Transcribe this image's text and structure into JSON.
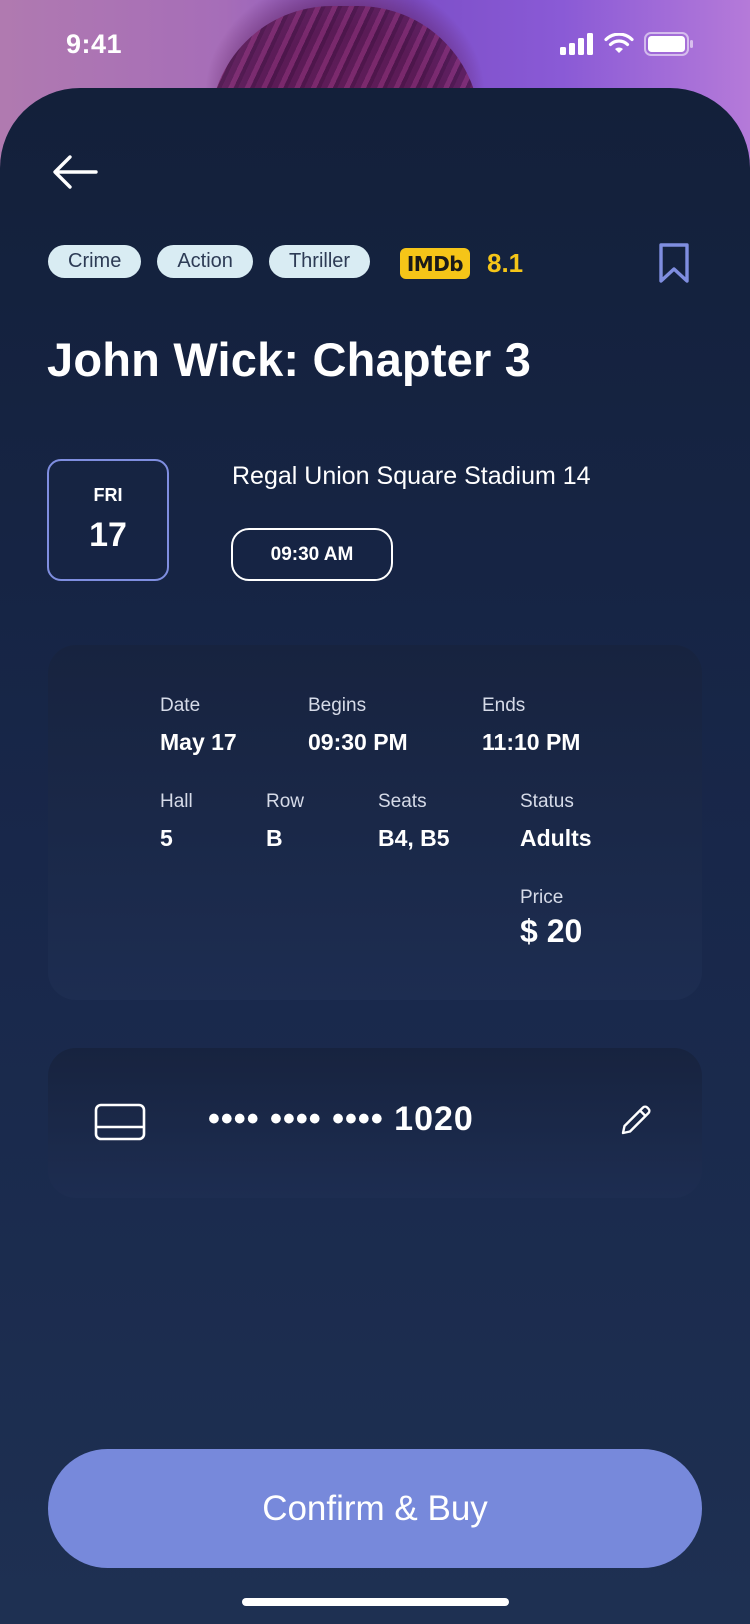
{
  "status_bar": {
    "time": "9:41"
  },
  "genres": [
    "Crime",
    "Action",
    "Thriller"
  ],
  "rating": {
    "source": "IMDb",
    "score": "8.1"
  },
  "movie": {
    "title": "John Wick: Chapter 3"
  },
  "showtime": {
    "weekday": "FRI",
    "day": "17",
    "cinema": "Regal Union Square Stadium 14",
    "time": "09:30 AM"
  },
  "details": {
    "date": {
      "label": "Date",
      "value": "May 17"
    },
    "begins": {
      "label": "Begins",
      "value": "09:30 PM"
    },
    "ends": {
      "label": "Ends",
      "value": "11:10 PM"
    },
    "hall": {
      "label": "Hall",
      "value": "5"
    },
    "row": {
      "label": "Row",
      "value": "B"
    },
    "seats": {
      "label": "Seats",
      "value": "B4, B5"
    },
    "status": {
      "label": "Status",
      "value": "Adults"
    },
    "price": {
      "label": "Price",
      "value": "$ 20"
    }
  },
  "payment": {
    "card_number": "•••• •••• •••• 1020"
  },
  "actions": {
    "confirm_label": "Confirm & Buy"
  },
  "colors": {
    "accent": "#7789db",
    "imdb_yellow": "#f5c518",
    "tag_bg": "#d9ecf3",
    "background": "#1b2a48"
  }
}
